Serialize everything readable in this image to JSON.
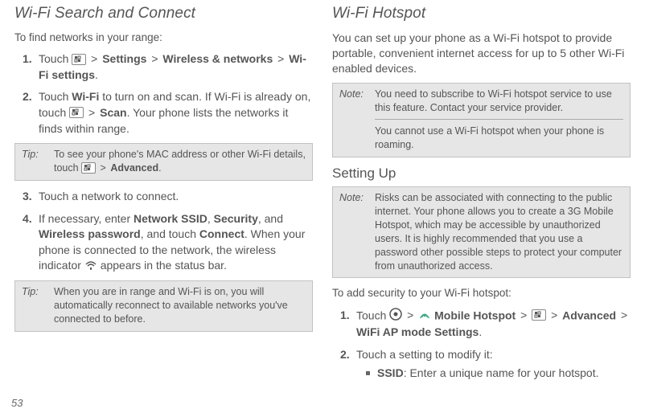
{
  "left": {
    "title": "Wi-Fi Search and Connect",
    "intro": "To find networks in your range:",
    "steps": {
      "s1_a": "Touch ",
      "s1_b": "Settings",
      "s1_c": "Wireless & networks",
      "s1_d": "Wi-Fi settings",
      "s2_a": "Touch ",
      "s2_b": "Wi-Fi",
      "s2_c": " to turn on and scan. If Wi-Fi is already on, touch ",
      "s2_d": "Scan",
      "s2_e": ". Your phone lists the networks it finds within range.",
      "s3": "Touch a network to connect.",
      "s4_a": "If necessary, enter ",
      "s4_b": "Network SSID",
      "s4_c": "Security",
      "s4_d": "Wireless password",
      "s4_e": ", and touch ",
      "s4_f": "Connect",
      "s4_g": ". When your phone is connected to the network, the wireless indicator ",
      "s4_h": " appears in the status bar."
    },
    "tip1": {
      "label": "Tip:",
      "body_a": "To see your phone's MAC address or other Wi-Fi details, touch ",
      "body_b": "Advanced",
      "body_c": "."
    },
    "tip2": {
      "label": "Tip:",
      "body": "When you are in range and Wi-Fi is on, you will automatically reconnect to available networks you've connected to before."
    }
  },
  "right": {
    "title": "Wi-Fi Hotspot",
    "intro": "You can set up your phone as a Wi-Fi hotspot to provide portable, convenient internet access for up to 5 other Wi-Fi enabled devices.",
    "note1": {
      "label": "Note:",
      "body1": "You need to subscribe to Wi-Fi hotspot service to use this feature. Contact your service provider.",
      "body2": "You cannot use a Wi-Fi hotspot when your phone is roaming."
    },
    "subhead": "Setting Up",
    "note2": {
      "label": "Note:",
      "body": "Risks can be associated with connecting to the public internet. Your phone allows you to create a 3G Mobile Hotspot, which may be accessible by unauthorized users. It is highly recommended that you use a password other possible steps to protect your computer from unauthorized access."
    },
    "intro2": "To add security to your Wi-Fi hotspot:",
    "steps": {
      "s1_a": "Touch ",
      "s1_b": "Mobile Hotspot",
      "s1_c": "Advanced",
      "s1_d": "WiFi AP mode Settings",
      "s2": "Touch a setting to modify it:",
      "bullet_a": "SSID",
      "bullet_b": ": Enter a unique name for your hotspot."
    }
  },
  "page_number": "53",
  "glyphs": {
    "gt": ">",
    "comma_sp": ", "
  }
}
